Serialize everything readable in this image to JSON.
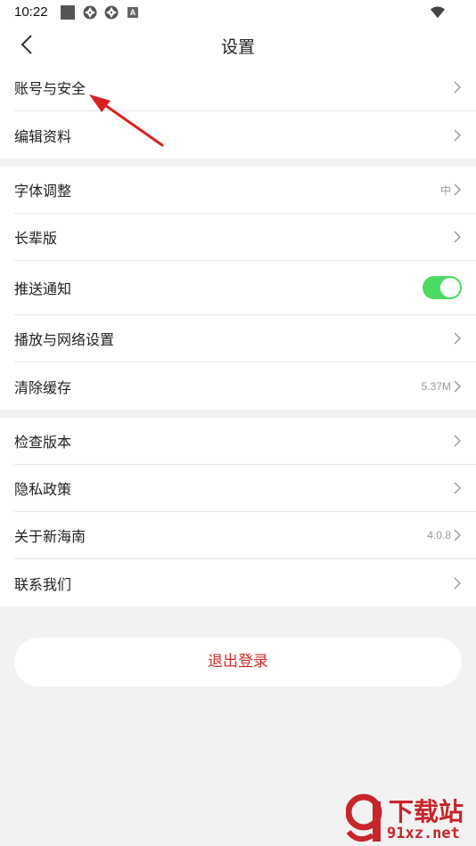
{
  "status_bar": {
    "time": "10:22",
    "notification_letter": "A"
  },
  "header": {
    "title": "设置"
  },
  "sections": [
    {
      "items": [
        {
          "label": "账号与安全",
          "value": ""
        },
        {
          "label": "编辑资料",
          "value": ""
        }
      ]
    },
    {
      "items": [
        {
          "label": "字体调整",
          "value": "中"
        },
        {
          "label": "长辈版",
          "value": ""
        },
        {
          "label": "推送通知",
          "toggle": true
        },
        {
          "label": "播放与网络设置",
          "value": ""
        },
        {
          "label": "清除缓存",
          "value": "5.37M"
        }
      ]
    },
    {
      "items": [
        {
          "label": "检查版本",
          "value": ""
        },
        {
          "label": "隐私政策",
          "value": ""
        },
        {
          "label": "关于新海南",
          "value": "4.0.8"
        },
        {
          "label": "联系我们",
          "value": ""
        }
      ]
    }
  ],
  "logout": {
    "label": "退出登录"
  },
  "colors": {
    "accent_red": "#d62a2a",
    "toggle_on": "#4cd964",
    "arrow": "#d9201e"
  },
  "watermark": {
    "top": "下载站",
    "bottom": "91xz.net"
  }
}
